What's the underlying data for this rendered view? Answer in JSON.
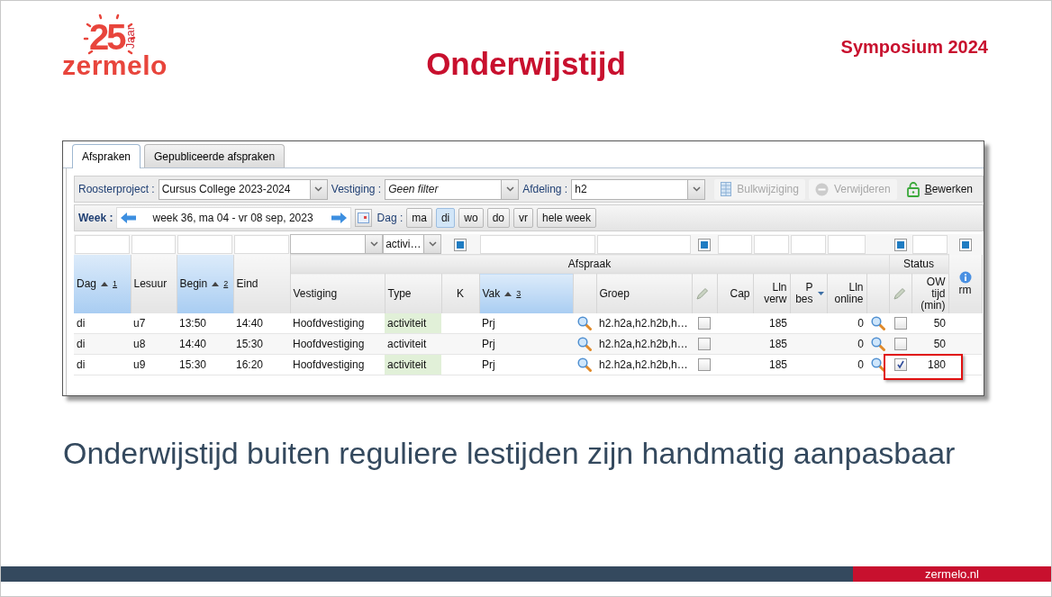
{
  "logo": {
    "number": "25",
    "jaar": "Jaar",
    "name": "zermelo"
  },
  "title": "Onderwijstijd",
  "event": "Symposium 2024",
  "app": {
    "tabs": [
      {
        "label": "Afspraken",
        "selected": true
      },
      {
        "label": "Gepubliceerde afspraken",
        "selected": false
      }
    ],
    "toolbar": {
      "roosterproject_label": "Roosterproject :",
      "roosterproject": "Cursus College 2023-2024",
      "vestiging_label": "Vestiging :",
      "vestiging_placeholder": "Geen filter",
      "afdeling_label": "Afdeling :",
      "afdeling": "h2",
      "buttons": [
        {
          "label": "Bulkwijziging",
          "kind": "grid",
          "disabled": true
        },
        {
          "label": "Verwijderen",
          "kind": "remove",
          "disabled": true
        },
        {
          "label": "Bewerken",
          "kind": "lock",
          "disabled": false
        }
      ]
    },
    "week": {
      "label": "Week :",
      "range": "week 36, ma 04 - vr 08 sep, 2023",
      "dag_label": "Dag :",
      "days": [
        {
          "label": "ma",
          "selected": false
        },
        {
          "label": "di",
          "selected": true
        },
        {
          "label": "wo",
          "selected": false
        },
        {
          "label": "do",
          "selected": false
        },
        {
          "label": "vr",
          "selected": false
        },
        {
          "label": "hele week",
          "selected": false
        }
      ]
    },
    "type_filter": "activi…",
    "columns": [
      {
        "kind": "column",
        "label": "Dag",
        "sorted": true,
        "sort_order": "1"
      },
      {
        "kind": "column",
        "label": "Lesuur",
        "sorted": false
      },
      {
        "kind": "column",
        "label": "Begin",
        "sorted": true,
        "sort_order": "2"
      },
      {
        "kind": "column",
        "label": "Eind",
        "sorted": false
      },
      {
        "kind": "group",
        "label": "Afspraak",
        "columns": [
          {
            "kind": "text",
            "label": "Vestiging",
            "sorted": false
          },
          {
            "kind": "text",
            "label": "Type",
            "sorted": false
          },
          {
            "kind": "text",
            "label": "K",
            "sorted": false
          },
          {
            "kind": "text",
            "label": "Vak",
            "sorted": true,
            "sort_order": "3"
          },
          {
            "kind": "blank",
            "sorted": false
          },
          {
            "kind": "text",
            "label": "Groep",
            "sorted": false
          },
          {
            "kind": "edit",
            "sorted": false
          },
          {
            "kind": "text",
            "label": "Cap",
            "sorted": false
          },
          {
            "kind": "text",
            "label": "Lln\nverw",
            "sorted": false
          },
          {
            "kind": "menu",
            "label": "P\nbes",
            "sorted": false
          },
          {
            "kind": "text",
            "label": "Lln\nonline",
            "sorted": false
          },
          {
            "kind": "blank",
            "sorted": false
          }
        ]
      },
      {
        "kind": "group",
        "label": "Status",
        "columns": [
          {
            "kind": "edit",
            "sorted": false
          },
          {
            "kind": "text",
            "label": "OW\ntijd\n(min)",
            "sorted": false
          }
        ]
      },
      {
        "kind": "info_column",
        "label": "rm",
        "sorted": false
      }
    ],
    "rows": [
      {
        "dag": "di",
        "lesuur": "u7",
        "begin": "13:50",
        "eind": "14:40",
        "vestiging": "Hoofdvestiging",
        "type": "activiteit",
        "vak": "Prj",
        "groep": "h2.h2a,h2.h2b,h…",
        "flag": false,
        "lln_verw": "185",
        "lln_online": "0",
        "status": false,
        "ow_tijd": "50",
        "highlighted": false
      },
      {
        "dag": "di",
        "lesuur": "u8",
        "begin": "14:40",
        "eind": "15:30",
        "vestiging": "Hoofdvestiging",
        "type": "activiteit",
        "vak": "Prj",
        "groep": "h2.h2a,h2.h2b,h…",
        "flag": false,
        "lln_verw": "185",
        "lln_online": "0",
        "status": false,
        "ow_tijd": "50",
        "highlighted": false
      },
      {
        "dag": "di",
        "lesuur": "u9",
        "begin": "15:30",
        "eind": "16:20",
        "vestiging": "Hoofdvestiging",
        "type": "activiteit",
        "vak": "Prj",
        "groep": "h2.h2a,h2.h2b,h…",
        "flag": false,
        "lln_verw": "185",
        "lln_online": "0",
        "status": true,
        "ow_tijd": "180",
        "highlighted": true
      }
    ]
  },
  "caption": "Onderwijstijd buiten reguliere lestijden zijn handmatig aanpasbaar",
  "footer": {
    "site": "zermelo.nl"
  }
}
